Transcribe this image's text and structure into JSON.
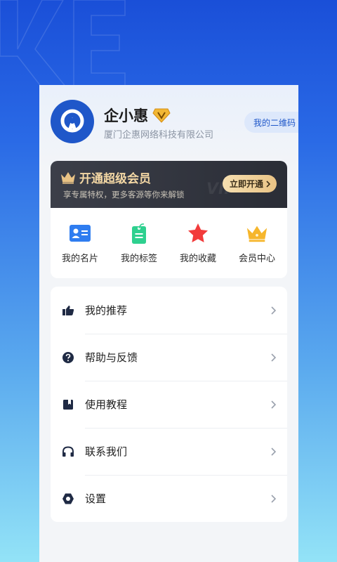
{
  "profile": {
    "name": "企小惠",
    "company": "厦门企惠网络科技有限公司",
    "qr_button": "我的二维码"
  },
  "vip": {
    "title": "开通超级会员",
    "subtitle": "享专属特权，更多客源等你来解锁",
    "button": "立即开通",
    "watermark": "VIP"
  },
  "quick_actions": [
    {
      "label": "我的名片",
      "icon": "business-card-icon"
    },
    {
      "label": "我的标签",
      "icon": "tag-icon"
    },
    {
      "label": "我的收藏",
      "icon": "star-icon"
    },
    {
      "label": "会员中心",
      "icon": "crown-icon"
    }
  ],
  "menu": [
    {
      "label": "我的推荐",
      "icon": "thumbs-up-icon"
    },
    {
      "label": "帮助与反馈",
      "icon": "help-icon"
    },
    {
      "label": "使用教程",
      "icon": "bookmark-icon"
    },
    {
      "label": "联系我们",
      "icon": "headset-icon"
    },
    {
      "label": "设置",
      "icon": "gear-icon"
    }
  ],
  "colors": {
    "brand": "#1f57c9",
    "vip_gold": "#f3d7a4",
    "background_top": "#1a4fd8",
    "background_bottom": "#93e3f7"
  }
}
